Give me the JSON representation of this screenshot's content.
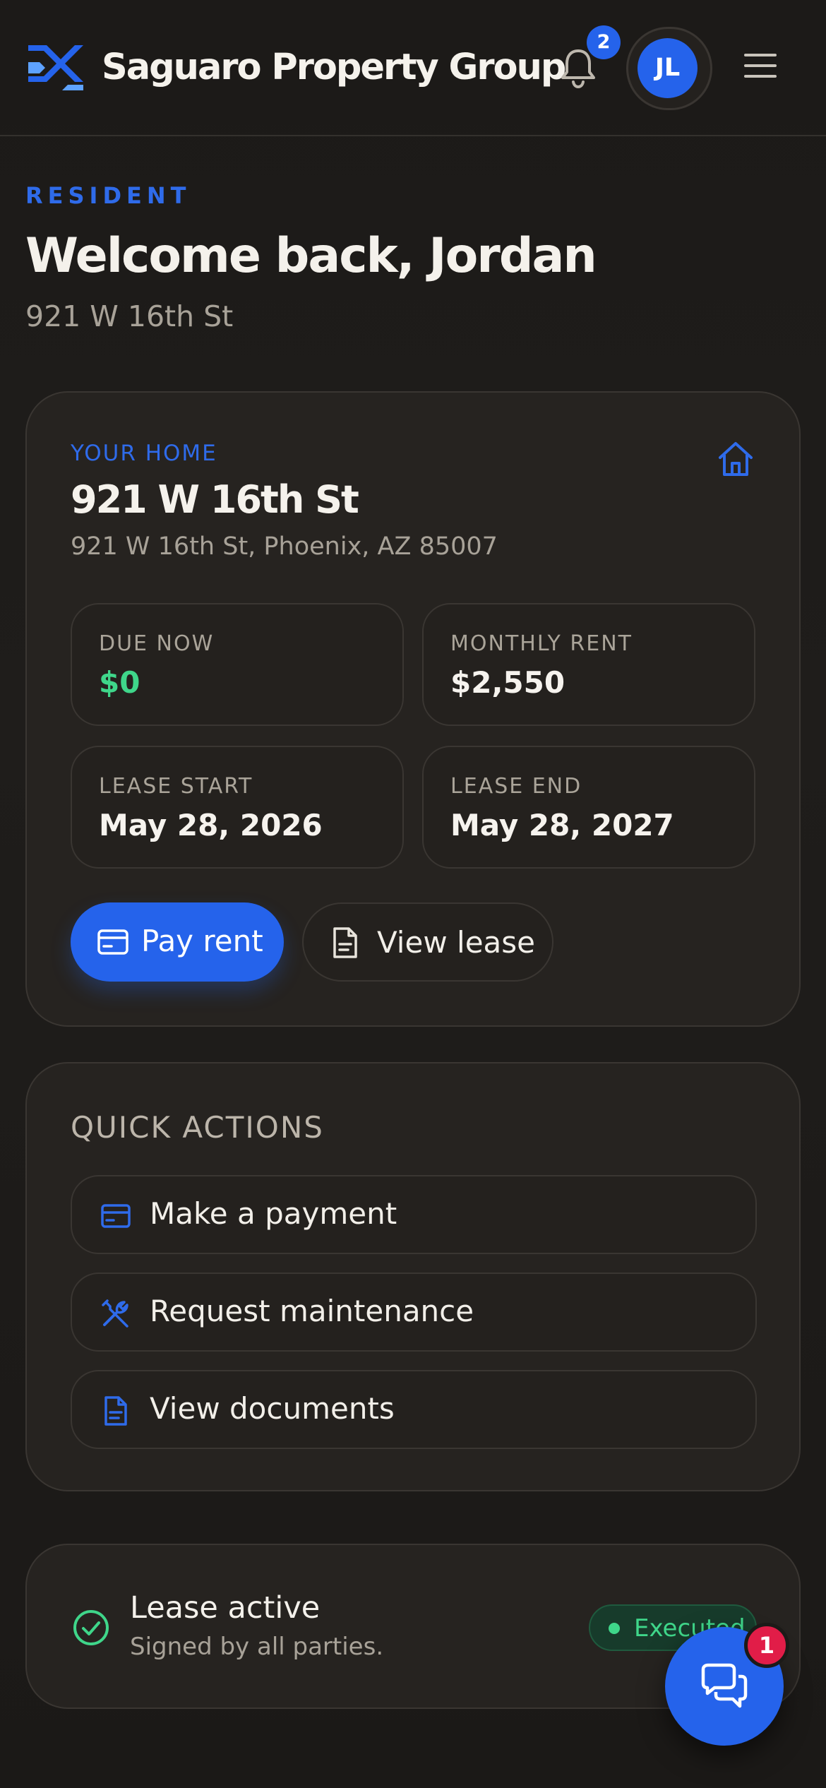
{
  "header": {
    "brand": "Saguaro Property Group",
    "notifications_count": "2",
    "avatar_initials": "JL"
  },
  "intro": {
    "eyebrow": "RESIDENT",
    "welcome": "Welcome back, Jordan",
    "address": "921 W 16th St"
  },
  "home": {
    "label": "YOUR HOME",
    "title": "921 W 16th St",
    "full_address": "921 W 16th St, Phoenix, AZ 85007",
    "stats": [
      {
        "label": "DUE NOW",
        "value": "$0"
      },
      {
        "label": "MONTHLY RENT",
        "value": "$2,550"
      },
      {
        "label": "LEASE START",
        "value": "May 28, 2026"
      },
      {
        "label": "LEASE END",
        "value": "May 28, 2027"
      }
    ],
    "pay_button": "Pay rent",
    "lease_button": "View lease"
  },
  "quick_actions": {
    "title": "QUICK ACTIONS",
    "items": [
      {
        "label": "Make a payment",
        "icon": "credit-card-icon"
      },
      {
        "label": "Request maintenance",
        "icon": "tools-icon"
      },
      {
        "label": "View documents",
        "icon": "document-icon"
      }
    ]
  },
  "lease_status": {
    "title": "Lease active",
    "subtitle": "Signed by all parties.",
    "badge": "Executed"
  },
  "chat": {
    "unread": "1"
  },
  "colors": {
    "accent": "#2563eb",
    "success": "#3fd68a",
    "alert": "#e11d48",
    "background": "#1c1a18",
    "card": "#262320"
  }
}
